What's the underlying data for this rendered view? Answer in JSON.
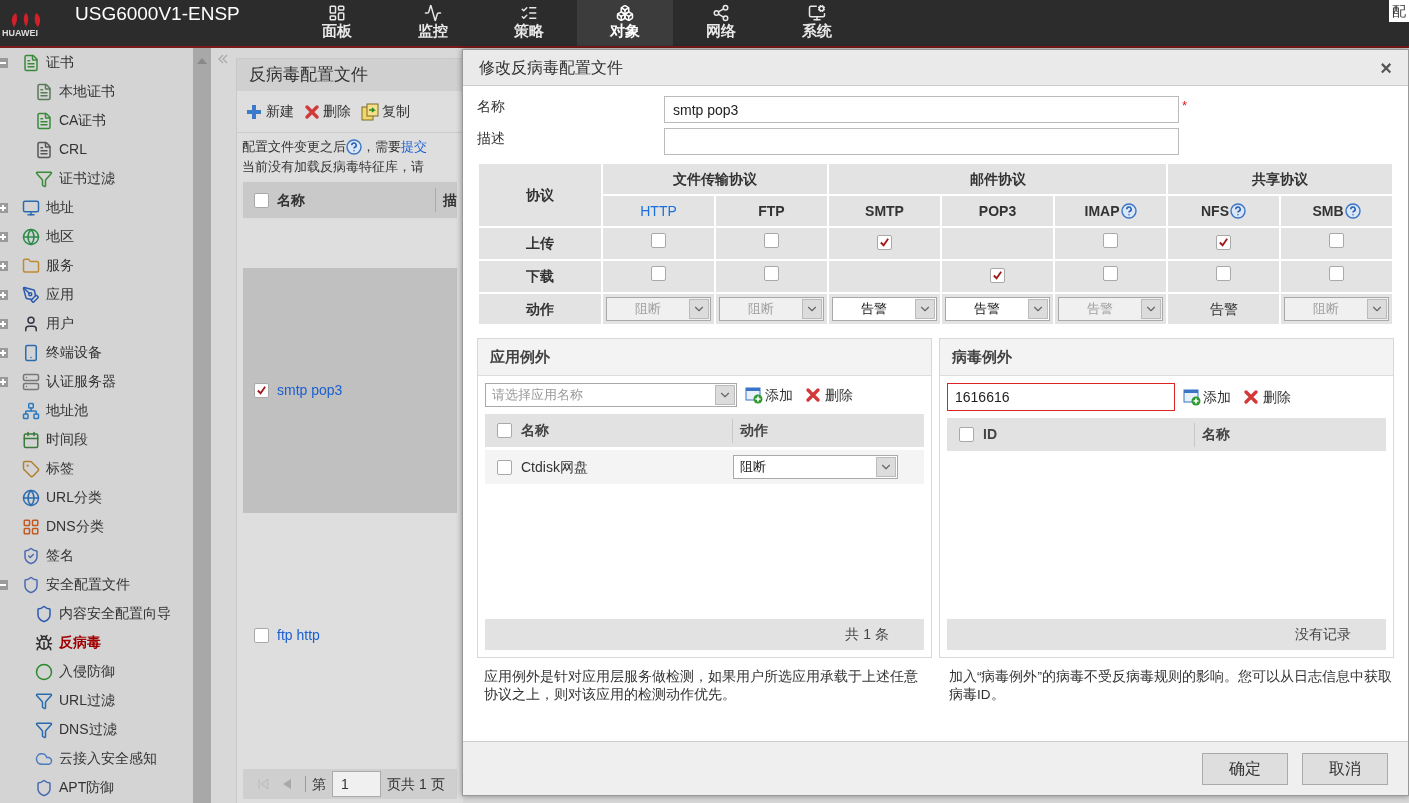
{
  "header": {
    "brand": "HUAWEI",
    "title": "USG6000V1-ENSP",
    "corner_button": "配",
    "nav": [
      {
        "label": "面板",
        "selected": false
      },
      {
        "label": "监控",
        "selected": false
      },
      {
        "label": "策略",
        "selected": false
      },
      {
        "label": "对象",
        "selected": true
      },
      {
        "label": "网络",
        "selected": false
      },
      {
        "label": "系统",
        "selected": false
      }
    ]
  },
  "sidebar": {
    "items": [
      {
        "label": "证书",
        "expanded": true,
        "selected": false,
        "children": [
          {
            "label": "本地证书",
            "selected": false
          },
          {
            "label": "CA证书",
            "selected": false
          },
          {
            "label": "CRL",
            "selected": false
          },
          {
            "label": "证书过滤",
            "selected": false
          }
        ]
      },
      {
        "label": "地址",
        "expanded": false,
        "selected": false
      },
      {
        "label": "地区",
        "expanded": false,
        "selected": false
      },
      {
        "label": "服务",
        "expanded": false,
        "selected": false
      },
      {
        "label": "应用",
        "expanded": false,
        "selected": false
      },
      {
        "label": "用户",
        "expanded": false,
        "selected": false
      },
      {
        "label": "终端设备",
        "expanded": false,
        "selected": false
      },
      {
        "label": "认证服务器",
        "expanded": false,
        "selected": false
      },
      {
        "label": "地址池",
        "selected": false
      },
      {
        "label": "时间段",
        "selected": false
      },
      {
        "label": "标签",
        "selected": false
      },
      {
        "label": "URL分类",
        "selected": false
      },
      {
        "label": "DNS分类",
        "selected": false
      },
      {
        "label": "签名",
        "selected": false
      },
      {
        "label": "安全配置文件",
        "expanded": true,
        "selected": false,
        "children": [
          {
            "label": "内容安全配置向导",
            "selected": false
          },
          {
            "label": "反病毒",
            "selected": true
          },
          {
            "label": "入侵防御",
            "selected": false
          },
          {
            "label": "URL过滤",
            "selected": false
          },
          {
            "label": "DNS过滤",
            "selected": false
          },
          {
            "label": "云接入安全感知",
            "selected": false
          },
          {
            "label": "APT防御",
            "selected": false
          }
        ]
      }
    ]
  },
  "main": {
    "title": "反病毒配置文件",
    "toolbar": [
      {
        "kind": "add",
        "label": "新建"
      },
      {
        "kind": "delete",
        "label": "删除"
      },
      {
        "kind": "copy",
        "label": "复制"
      }
    ],
    "notice": {
      "before": "配置文件变更之后",
      "after": "，需要",
      "link": "提交"
    },
    "notice2": "当前没有加载反病毒特征库，请",
    "table": {
      "all_checked": false,
      "columns": [
        "名称",
        "描"
      ],
      "rows": [
        {
          "name": "smtp pop3",
          "checked": true,
          "selected": true
        },
        {
          "name": "ftp http",
          "checked": false,
          "selected": false
        }
      ]
    },
    "pager": {
      "before": "第",
      "page": "1",
      "after": "页共 1 页"
    }
  },
  "dialog": {
    "title": "修改反病毒配置文件",
    "close": "×",
    "fields": [
      {
        "label": "名称",
        "value": "smtp pop3",
        "required": "*"
      },
      {
        "label": "描述"
      }
    ],
    "protocols": {
      "corner": "协议",
      "row_labels": [
        "上传",
        "下载",
        "动作"
      ],
      "groups": [
        {
          "label": "文件传输协议",
          "columns": [
            {
              "label": "HTTP",
              "link": true,
              "help": false,
              "upload": {
                "checked": false
              },
              "download": {
                "checked": false
              },
              "action": {
                "kind": "select",
                "value": "阻断",
                "disabled": true
              }
            },
            {
              "label": "FTP",
              "link": false,
              "help": false,
              "upload": {
                "checked": false
              },
              "download": {
                "checked": false
              },
              "action": {
                "kind": "select",
                "value": "阻断",
                "disabled": true
              }
            }
          ]
        },
        {
          "label": "邮件协议",
          "columns": [
            {
              "label": "SMTP",
              "link": false,
              "help": false,
              "upload": {
                "checked": true
              },
              "action": {
                "kind": "select",
                "value": "告警",
                "disabled": false
              }
            },
            {
              "label": "POP3",
              "link": false,
              "help": false,
              "download": {
                "checked": true
              },
              "action": {
                "kind": "select",
                "value": "告警",
                "disabled": false
              }
            },
            {
              "label": "IMAP",
              "link": false,
              "help": true,
              "upload": {
                "checked": false
              },
              "download": {
                "checked": false
              },
              "action": {
                "kind": "select",
                "value": "告警",
                "disabled": true
              }
            }
          ]
        },
        {
          "label": "共享协议",
          "columns": [
            {
              "label": "NFS",
              "link": false,
              "help": true,
              "upload": {
                "checked": true
              },
              "download": {
                "checked": false
              },
              "action": {
                "kind": "text",
                "value": "告警"
              }
            },
            {
              "label": "SMB",
              "link": false,
              "help": true,
              "upload": {
                "checked": false
              },
              "download": {
                "checked": false
              },
              "action": {
                "kind": "select",
                "value": "阻断",
                "disabled": true
              }
            }
          ]
        }
      ]
    },
    "app_exceptions": {
      "title": "应用例外",
      "kind": "select",
      "placeholder": "请选择应用名称",
      "add": "添加",
      "delete": "删除",
      "all_checked": false,
      "columns": [
        "名称",
        "动作"
      ],
      "rows": [
        {
          "name": "Ctdisk网盘",
          "checked": false,
          "action": "阻断"
        }
      ],
      "footer": "共 1 条",
      "note": "应用例外是针对应用层服务做检测，如果用户所选应用承载于上述任意协议之上，则对该应用的检测动作优先。"
    },
    "virus_exceptions": {
      "title": "病毒例外",
      "kind": "input",
      "value": "1616616",
      "error": true,
      "add": "添加",
      "delete": "删除",
      "all_checked": false,
      "columns": [
        "ID",
        "名称"
      ],
      "footer": "没有记录",
      "note": "加入“病毒例外”的病毒不受反病毒规则的影响。您可以从日志信息中获取病毒ID。"
    },
    "buttons": [
      "确定",
      "取消"
    ]
  }
}
